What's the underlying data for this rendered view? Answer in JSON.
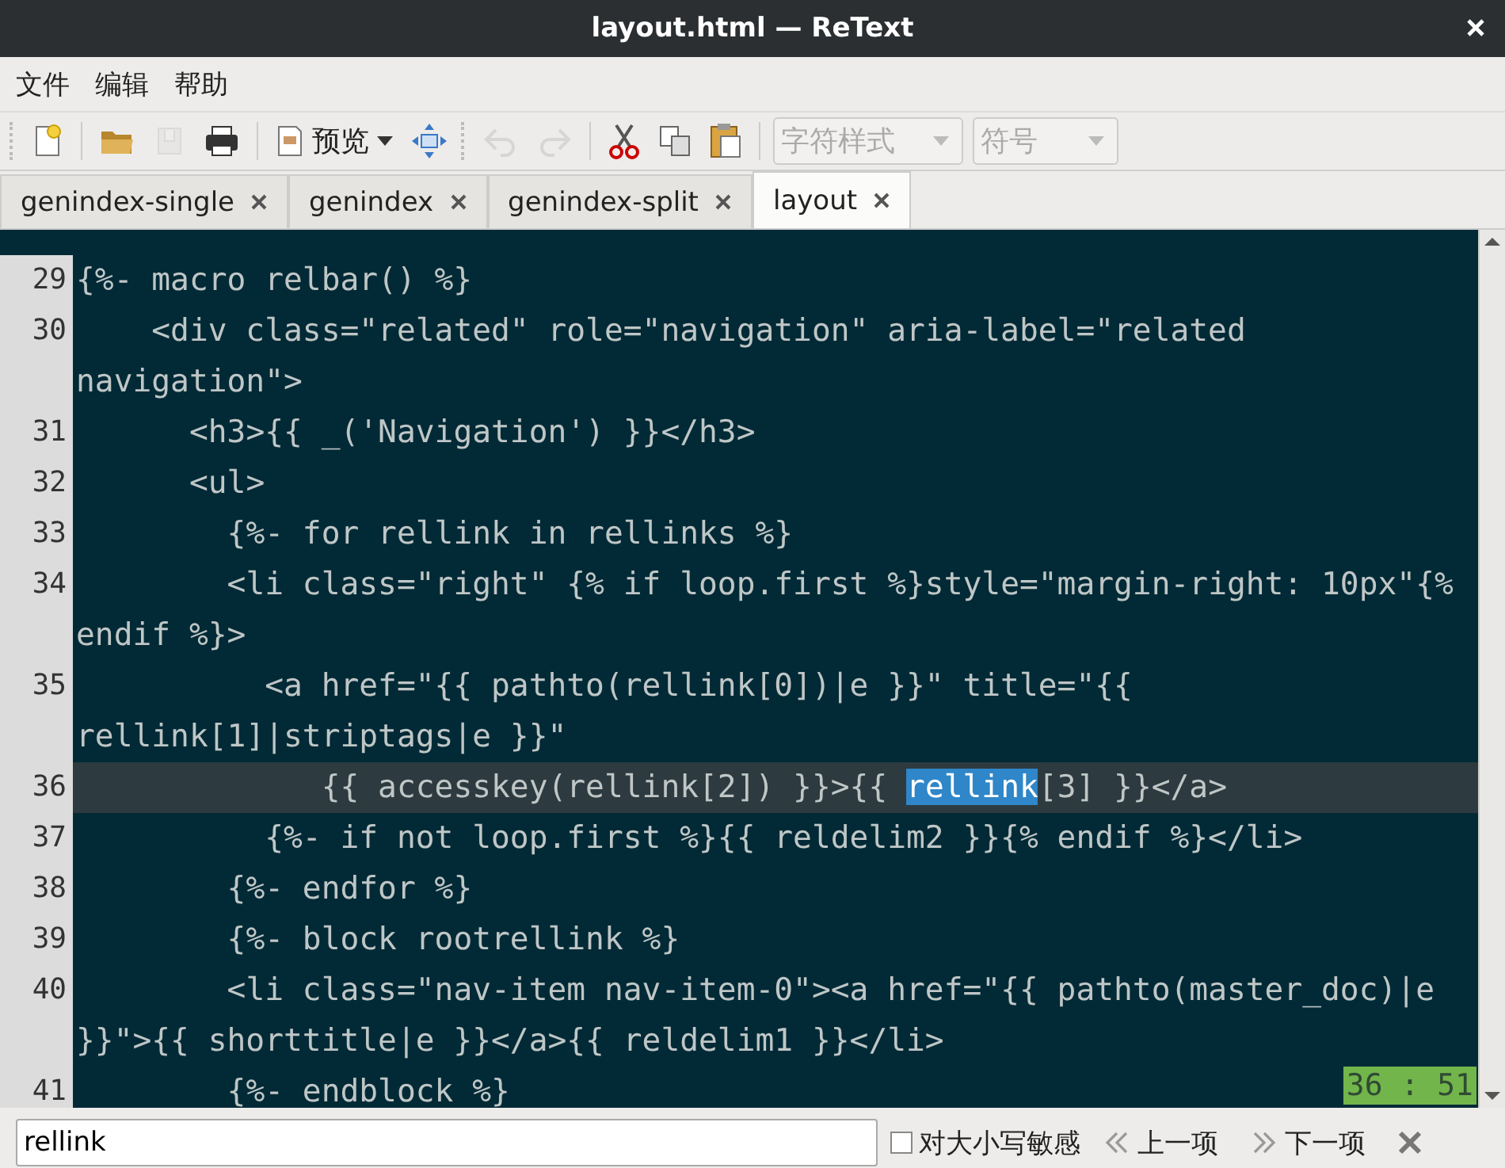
{
  "window": {
    "title": "layout.html — ReText"
  },
  "menu": [
    "文件",
    "编辑",
    "帮助"
  ],
  "toolbar": [
    {
      "kind": "new",
      "disabled": false
    },
    {
      "kind": "open",
      "disabled": false
    },
    {
      "kind": "save",
      "disabled": true
    },
    {
      "kind": "print",
      "disabled": false
    },
    {
      "kind": "preview",
      "label": "预览",
      "disabled": false
    },
    {
      "kind": "move",
      "disabled": false
    },
    {
      "kind": "undo",
      "disabled": true
    },
    {
      "kind": "redo",
      "disabled": true
    },
    {
      "kind": "cut",
      "disabled": false
    },
    {
      "kind": "copy",
      "disabled": false
    },
    {
      "kind": "paste",
      "disabled": false
    },
    {
      "kind": "combo",
      "label": "字符样式",
      "disabled": true
    },
    {
      "kind": "combo",
      "label": "符号",
      "disabled": true
    }
  ],
  "tabs": [
    {
      "label": "genindex-single",
      "selected": false
    },
    {
      "label": "genindex",
      "selected": false
    },
    {
      "label": "genindex-split",
      "selected": false
    },
    {
      "label": "layout",
      "selected": true
    }
  ],
  "lines": [
    {
      "number": "29",
      "current": false,
      "text": "{%- macro relbar() %}"
    },
    {
      "number": "30",
      "current": false,
      "text": "    <div class=\"related\" role=\"navigation\" aria-label=\"related navigation\">"
    },
    {
      "number": "31",
      "current": false,
      "text": "      <h3>{{ _('Navigation') }}</h3>"
    },
    {
      "number": "32",
      "current": false,
      "text": "      <ul>"
    },
    {
      "number": "33",
      "current": false,
      "text": "        {%- for rellink in rellinks %}"
    },
    {
      "number": "34",
      "current": false,
      "text": "        <li class=\"right\" {% if loop.first %}style=\"margin-right: 10px\"{% endif %}>"
    },
    {
      "number": "35",
      "current": false,
      "text": "          <a href=\"{{ pathto(rellink[0])|e }}\" title=\"{{ rellink[1]|striptags|e }}\""
    },
    {
      "number": "36",
      "current": true,
      "parts": [
        {
          "text": "             {{ accesskey(rellink[2]) }}>{{ ",
          "selected": false
        },
        {
          "text": "rellink",
          "selected": true
        },
        {
          "text": "[3] }}</a>",
          "selected": false
        }
      ]
    },
    {
      "number": "37",
      "current": false,
      "text": "          {%- if not loop.first %}{{ reldelim2 }}{% endif %}</li>"
    },
    {
      "number": "38",
      "current": false,
      "text": "        {%- endfor %}"
    },
    {
      "number": "39",
      "current": false,
      "text": "        {%- block rootrellink %}"
    },
    {
      "number": "40",
      "current": false,
      "text": "        <li class=\"nav-item nav-item-0\"><a href=\"{{ pathto(master_doc)|e }}\">{{ shorttitle|e }}</a>{{ reldelim1 }}</li>"
    },
    {
      "number": "41",
      "current": false,
      "text": "        {%- endblock %}"
    }
  ],
  "position": "36 : 51",
  "find": {
    "value": "rellink",
    "case_sensitive": {
      "label": "对大小写敏感",
      "checked": false
    },
    "previous": "上一项",
    "next": "下一项"
  }
}
